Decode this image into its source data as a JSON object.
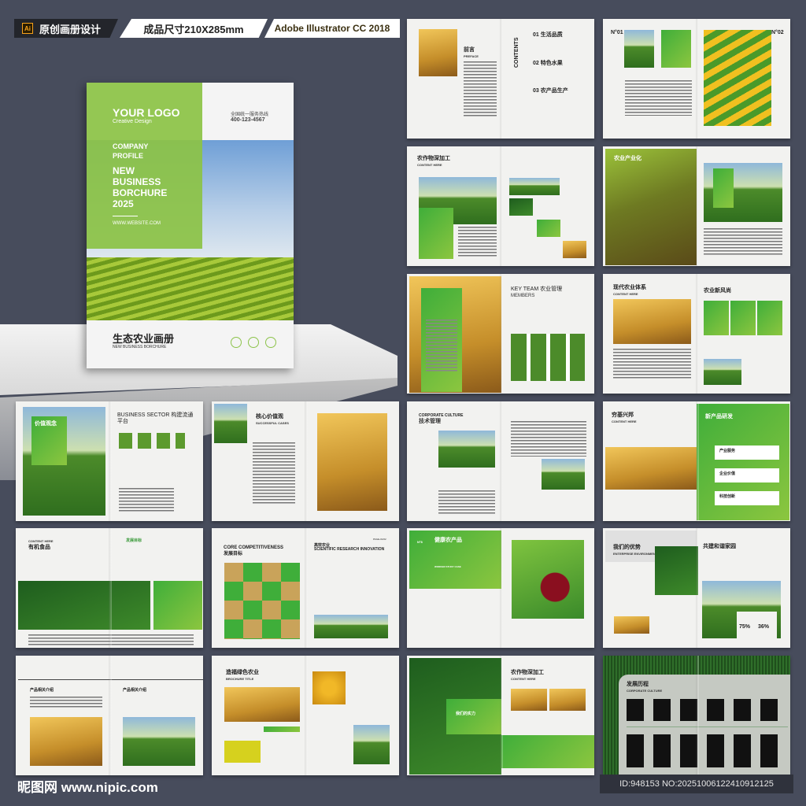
{
  "header": {
    "app_tag": "原创画册设计",
    "app_icon": "Ai",
    "size": "成品尺寸210X285mm",
    "software": "Adobe Illustrator CC 2018"
  },
  "cover": {
    "logo": "YOUR LOGO",
    "logo_sub": "Creative Design",
    "hotline_label": "全国统一服务热线",
    "hotline": "400-123-4567",
    "company": "COMPANY",
    "profile": "PROFILE",
    "t1": "NEW",
    "t2": "BUSINESS",
    "t3": "BORCHURE",
    "t4": "2025",
    "website": "WWW.WEBSITE.COM",
    "title_cn": "生态农业画册",
    "title_en": "NEW BUSINESS BORCHURE"
  },
  "spreads": {
    "preface": {
      "title": "前言",
      "sub": "PREFACE",
      "contents": "CONTENTS",
      "toc": [
        "01 生活品质",
        "02 特色水果",
        "03 农产品生产"
      ]
    },
    "n01": {
      "left": "N°01",
      "right": "N°02"
    },
    "deep": {
      "title": "农作物深加工",
      "sub": "CONTENT HERE"
    },
    "industry": {
      "title": "农业产业化"
    },
    "team": {
      "title": "KEY TEAM 农业管理",
      "sub": "MEMBERS"
    },
    "modern": {
      "title": "现代农业体系",
      "sub": "CONTENT HERE",
      "title2": "农业新风尚"
    },
    "sector": {
      "title": "BUSINESS SECTOR 构建流通平台",
      "badge": "价值观念"
    },
    "core": {
      "title": "核心价值观",
      "sub": "SUCCESSFUL CASES"
    },
    "culture": {
      "title": "CORPORATE CULTURE",
      "sub": "技术管理"
    },
    "rise": {
      "title": "穷基兴邦",
      "sub": "CONTENT HERE",
      "title2": "新产品研发",
      "items": [
        "产业服务",
        "企业价值",
        "科技创新"
      ]
    },
    "organic": {
      "sub": "CONTENT HERE",
      "title": "有机食品",
      "goal": "发展目标"
    },
    "compete": {
      "title": "CORE COMPETITIVENESS",
      "sub": "发展目标",
      "title2": "高效农业",
      "sub2": "SCIENTIFIC RESEARCH INNOVATION",
      "page": "PAGE-01/02"
    },
    "healthy": {
      "no": "N°8",
      "title": "健康农产品",
      "sub": "WORKER   STUDY   CASE"
    },
    "advantage": {
      "title": "我们的优势",
      "sub": "ENTERPRISE ENVIRONMENT",
      "title2": "共建和谐家园",
      "pct1": "75%",
      "pct2": "36%"
    },
    "product": {
      "title": "产品相关介绍",
      "title2": "产品相关介绍"
    },
    "green": {
      "title": "造福绿色农业",
      "sub": "BROCHURE TITLE"
    },
    "deep2": {
      "title": "农作物深加工",
      "sub": "CONTENT HERE",
      "badge": "我们的实力"
    },
    "history": {
      "title": "发展历程",
      "sub": "CORPORATE CULTURE"
    }
  },
  "footer": {
    "watermark": "昵图网 www.nipic.com",
    "id": "ID:948153 NO:20251006122410912125"
  }
}
